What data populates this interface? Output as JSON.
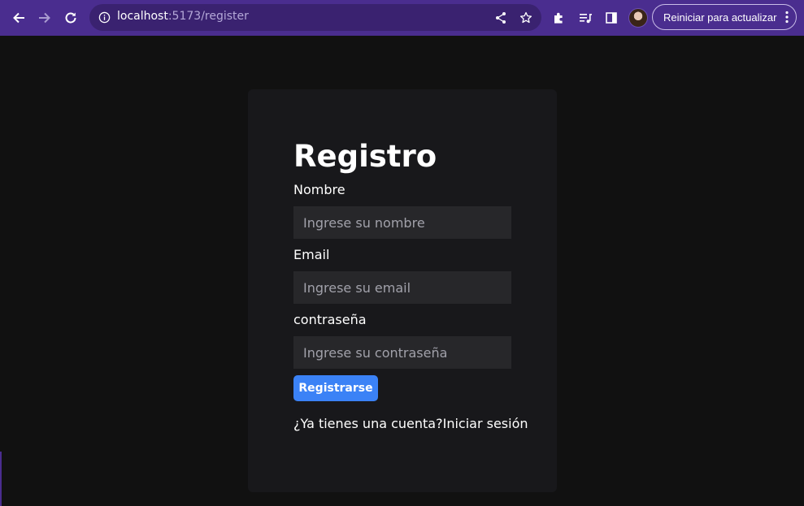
{
  "browser": {
    "url_host": "localhost",
    "url_path": ":5173/register",
    "update_button_label": "Reiniciar para actualizar",
    "icons": {
      "back": "arrow-left-icon",
      "forward": "arrow-right-icon",
      "reload": "reload-icon",
      "site_info": "info-circle-icon",
      "share": "share-icon",
      "bookmark": "star-icon",
      "extensions": "puzzle-icon",
      "media": "media-queue-icon",
      "side_panel": "side-panel-icon",
      "menu": "kebab-menu-icon"
    },
    "colors": {
      "toolbar": "#4a2d8f",
      "omnibox": "#3a2270"
    }
  },
  "register": {
    "title": "Registro",
    "name_label": "Nombre",
    "name_placeholder": "Ingrese su nombre",
    "email_label": "Email",
    "email_placeholder": "Ingrese su email",
    "password_label": "contraseña",
    "password_placeholder": "Ingrese su contraseña",
    "submit_label": "Registrarse",
    "login_prompt": "¿Ya tienes una cuenta?",
    "login_link": "Iniciar sesión"
  },
  "colors": {
    "page_background": "#111111",
    "card_background": "#18181b",
    "input_background": "#27272a",
    "accent": "#3b82f6"
  }
}
